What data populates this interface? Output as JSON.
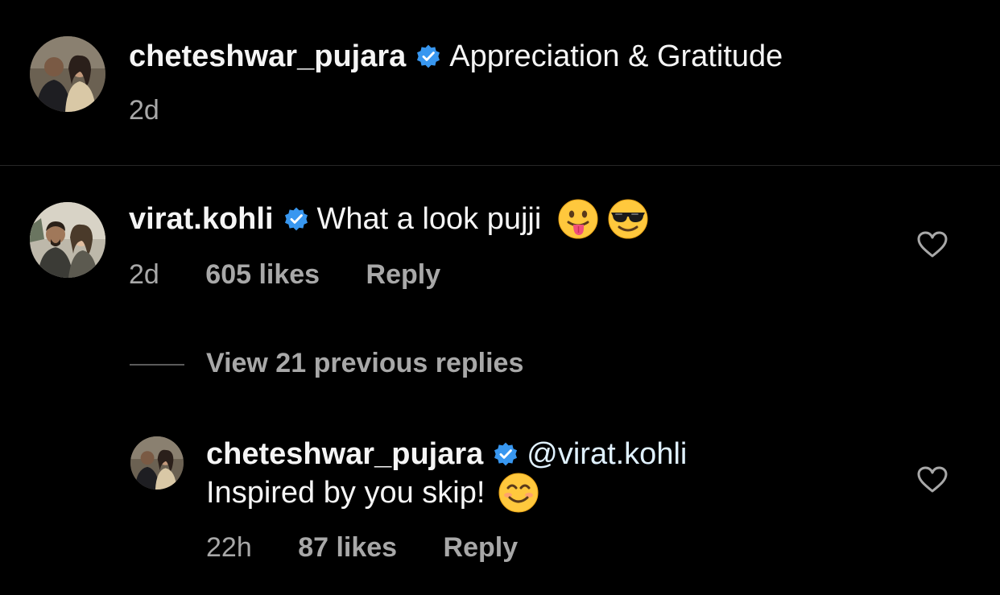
{
  "caption": {
    "username": "cheteshwar_pujara",
    "text": "Appreciation & Gratitude",
    "time": "2d"
  },
  "comment": {
    "username": "virat.kohli",
    "text": "What a look pujji",
    "emojis": [
      "face-with-tongue-icon",
      "smiling-face-with-sunglasses-icon"
    ],
    "time": "2d",
    "likes": "605 likes",
    "reply_label": "Reply"
  },
  "view_replies": "View 21 previous replies",
  "reply": {
    "username": "cheteshwar_pujara",
    "mention": "@virat.kohli",
    "text": "Inspired by you skip!",
    "emojis": [
      "smiling-face-icon"
    ],
    "time": "22h",
    "likes": "87 likes",
    "reply_label": "Reply"
  },
  "colors": {
    "background": "#000000",
    "verified_badge": "#3897f0",
    "muted_text": "#a8a8a8",
    "divider": "#262626"
  }
}
